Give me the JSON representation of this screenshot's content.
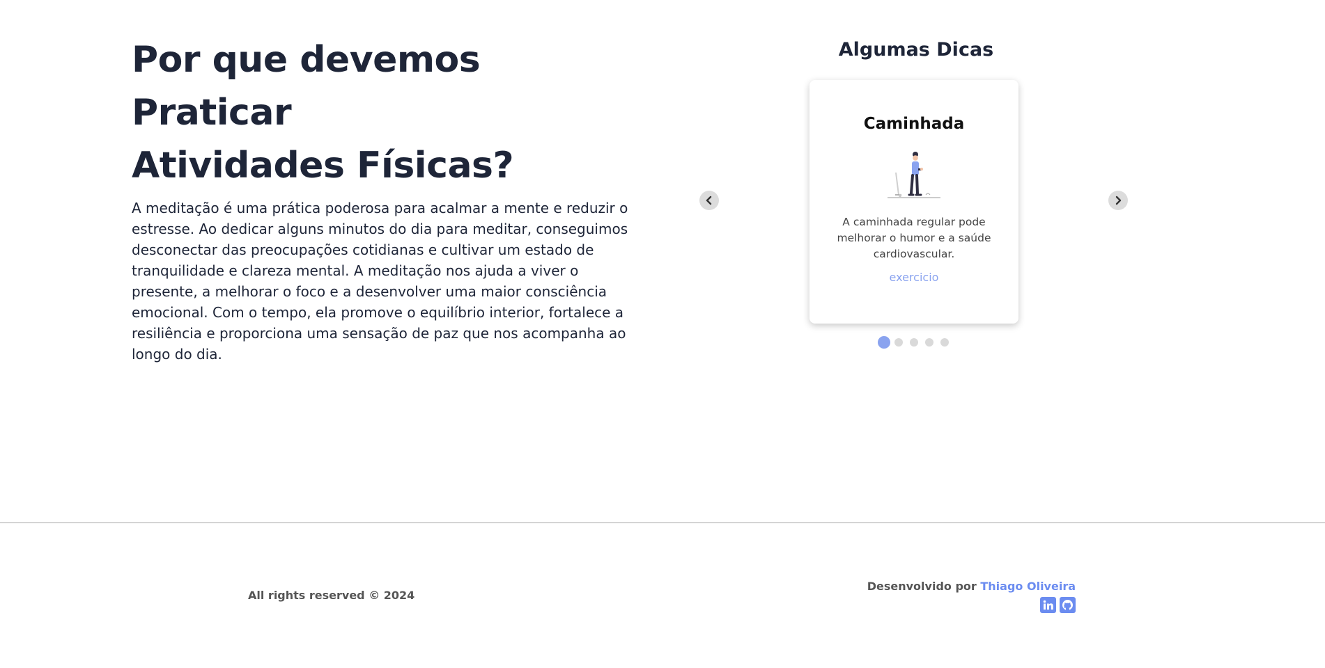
{
  "intro": {
    "title_line1": "Por que devemos Praticar",
    "title_line2": "Atividades Físicas?",
    "body": "A meditação é uma prática poderosa para acalmar a mente e reduzir o estresse. Ao dedicar alguns minutos do dia para meditar, conseguimos desconectar das preocupações cotidianas e cultivar um estado de tranquilidade e clareza mental. A meditação nos ajuda a viver o presente, a melhorar o foco e a desenvolver uma maior consciência emocional. Com o tempo, ela promove o equilíbrio interior, fortalece a resiliência e proporciona uma sensação de paz que nos acompanha ao longo do dia."
  },
  "tips": {
    "heading": "Algumas Dicas",
    "card": {
      "title": "Caminhada",
      "description": "A caminhada regular pode melhorar o humor e a saúde cardiovascular.",
      "tag": "exercicio",
      "illustration": "person-walking-illustration"
    },
    "prev_icon": "chevron-left-icon",
    "next_icon": "chevron-right-icon",
    "slide_count": 5,
    "active_slide": 1
  },
  "footer": {
    "rights": "All rights reserved © 2024",
    "dev_prefix": "Desenvolvido por",
    "dev_name": "Thiago Oliveira",
    "social_icons": [
      "linkedin-icon",
      "github-icon"
    ],
    "accent": "#6b8cf0"
  },
  "colors": {
    "heading": "#1e2538",
    "tag": "#8aa3ef",
    "dot_active": "#8aa3ef",
    "dot_inactive": "#d9d9d9"
  }
}
